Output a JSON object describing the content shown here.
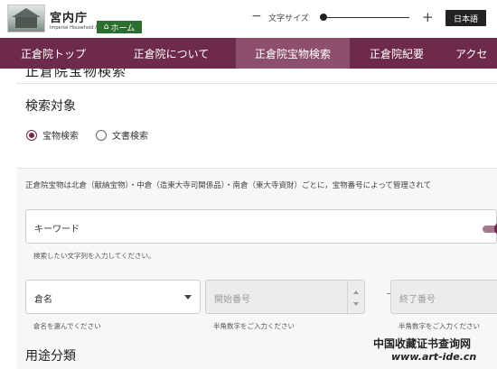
{
  "header": {
    "agency_name": "宮内庁",
    "agency_name_en": "Imperial Household Agency",
    "home_label": "ホーム",
    "font_size_label": "文字サイズ",
    "font_minus": "−",
    "font_plus": "+",
    "language_label": "日本語",
    "font_size_level": 0
  },
  "nav": {
    "items": [
      {
        "label": "正倉院トップ",
        "active": false
      },
      {
        "label": "正倉院について",
        "active": false
      },
      {
        "label": "正倉院宝物検索",
        "active": true
      },
      {
        "label": "正倉院紀要",
        "active": false
      },
      {
        "label": "アクセ",
        "active": false
      }
    ]
  },
  "page": {
    "cut_heading": "正倉院宝物検索",
    "search_target_title": "検索対象",
    "radio_treasure": "宝物検索",
    "radio_document": "文書検索",
    "selected_target": "宝物検索",
    "description": "正倉院宝物は北倉（献納宝物）・中倉（造東大寺司関係品）・南倉（東大寺資財）ごとに，宝物番号によって管理されて",
    "keyword_label": "キーワード",
    "keyword_help": "検索したい文字列を入力してください。",
    "keyword_toggle_on": true,
    "warehouse_label": "倉名",
    "warehouse_help": "倉名を選んでください",
    "start_number_placeholder": "開始番号",
    "start_number_help": "半角数字をご入力ください",
    "end_number_placeholder": "終了番号",
    "end_number_help": "半角数字をご入力ください",
    "usage_title": "用途分類"
  },
  "watermark": {
    "line1": "中国收藏证书查询网",
    "line2": "www.art-ide.cn"
  },
  "colors": {
    "brand": "#6e2a4a",
    "nav_active": "#8e4f6c",
    "home_green": "#2c6e2f"
  }
}
